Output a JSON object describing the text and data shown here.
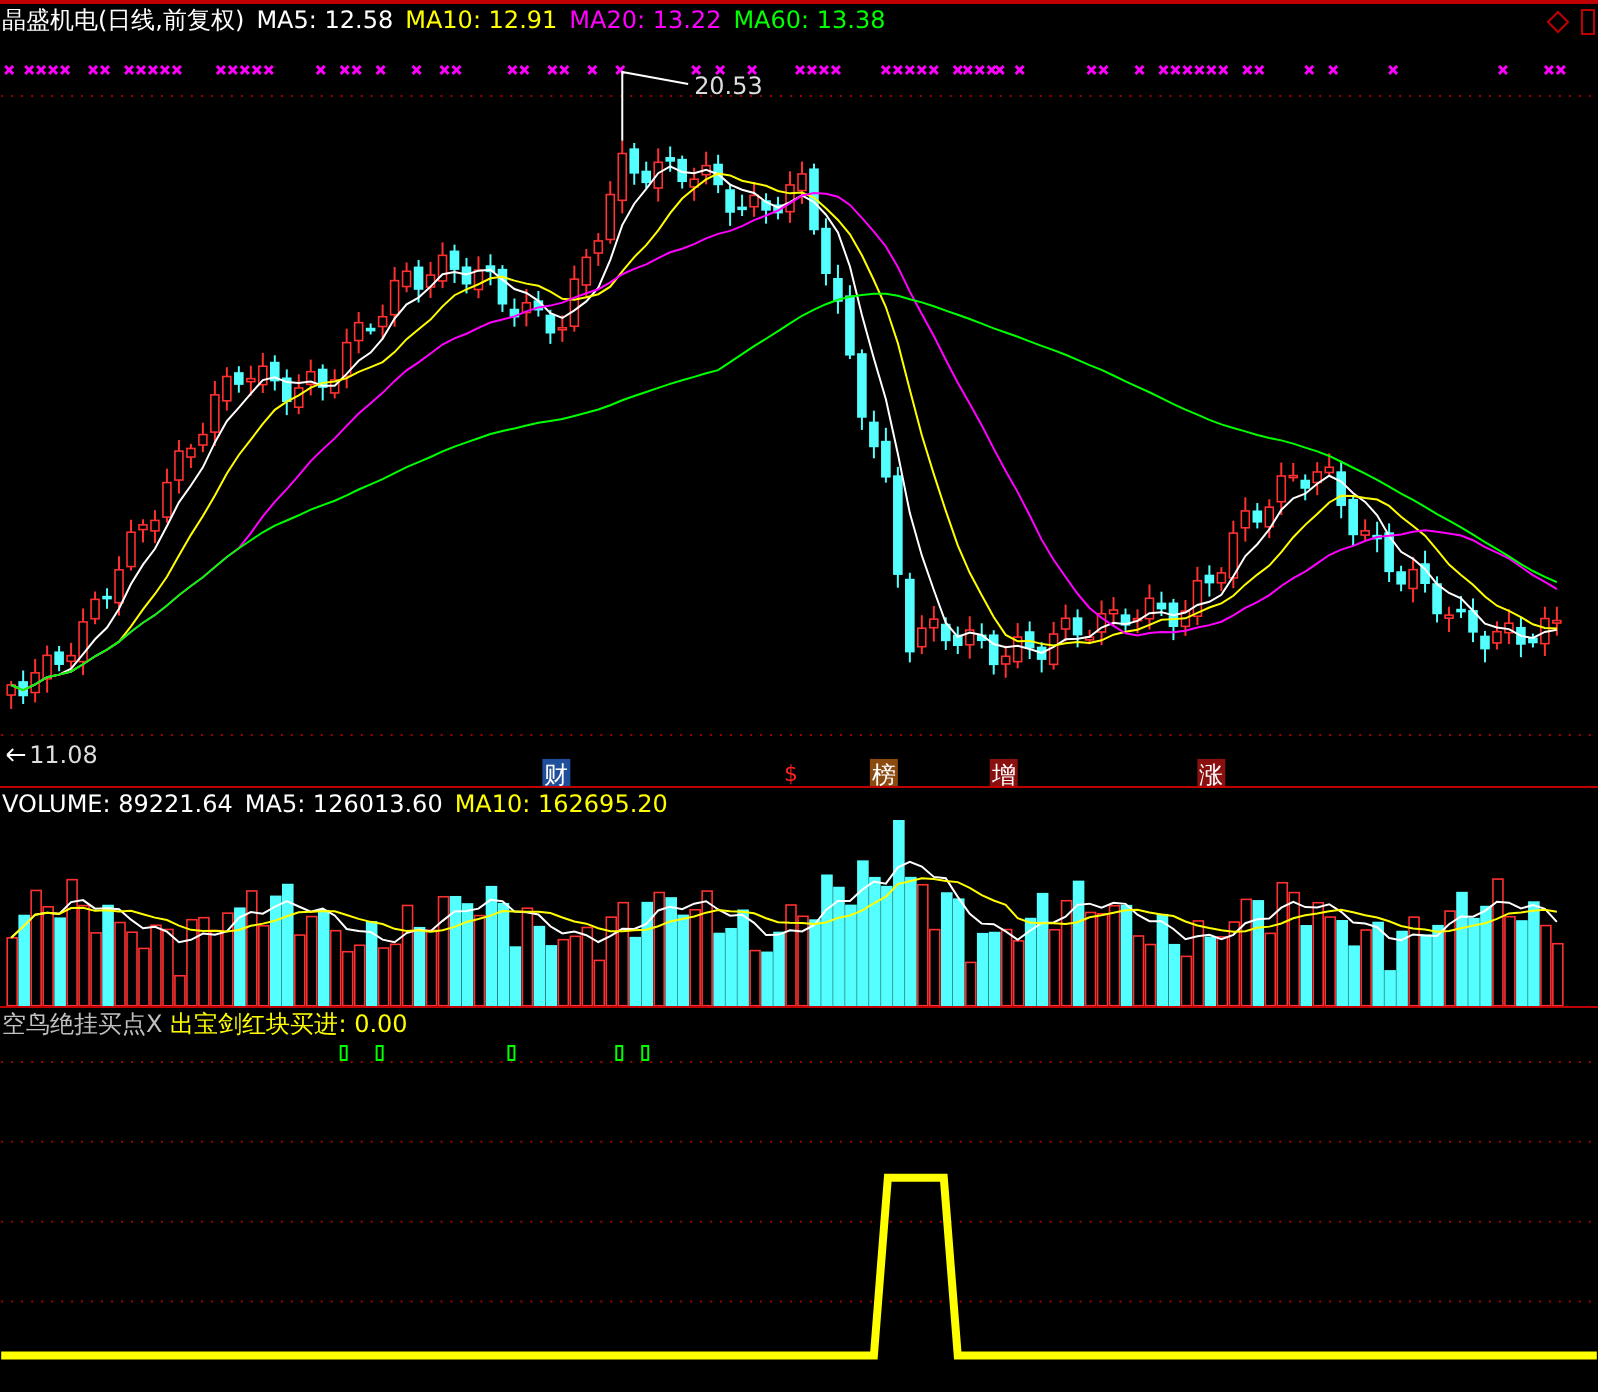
{
  "title": "晶盛机电(日线,前复权)",
  "ma_legend": [
    {
      "label": "MA5: 12.58",
      "color": "#ffffff"
    },
    {
      "label": "MA10: 12.91",
      "color": "#ffff00"
    },
    {
      "label": "MA20: 13.22",
      "color": "#ff00ff"
    },
    {
      "label": "MA60: 13.38",
      "color": "#00ff00"
    }
  ],
  "price_labels": {
    "high": "20.53",
    "low": "11.08"
  },
  "events": [
    {
      "text": "财",
      "kind": "badge",
      "color": "#1f4e9a"
    },
    {
      "text": "$",
      "kind": "glyph",
      "color": "#ff2020"
    },
    {
      "text": "榜",
      "kind": "badge",
      "color": "#8a4a10"
    },
    {
      "text": "增",
      "kind": "badge",
      "color": "#8a1010"
    },
    {
      "text": "涨",
      "kind": "badge",
      "color": "#8a1010"
    }
  ],
  "volume_legend": [
    {
      "label": "VOLUME: 89221.64",
      "color": "#ffffff"
    },
    {
      "label": "MA5: 126013.60",
      "color": "#ffffff"
    },
    {
      "label": "MA10: 162695.20",
      "color": "#ffff00"
    }
  ],
  "indicator_legend": [
    {
      "label": "空鸟绝挂买点X",
      "color": "#c0c0c0"
    },
    {
      "label": "出宝剑红块买进: 0.00",
      "color": "#ffff00"
    }
  ]
}
